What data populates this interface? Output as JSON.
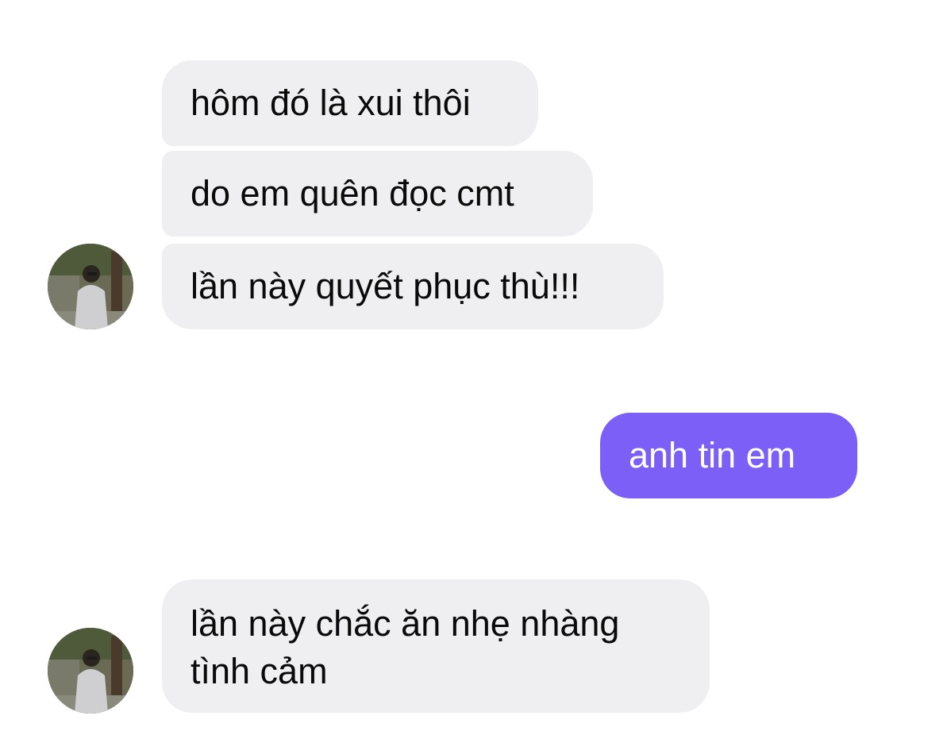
{
  "chat": {
    "messages": [
      {
        "sender": "contact",
        "text": "hôm đó là xui thôi"
      },
      {
        "sender": "contact",
        "text": "do em quên đọc cmt"
      },
      {
        "sender": "contact",
        "text": "lần này quyết phục thù!!!"
      },
      {
        "sender": "me",
        "text": "anh tin em"
      },
      {
        "sender": "contact",
        "lines": [
          "lần này chắc ăn nhẹ nhàng",
          "tình cảm"
        ]
      }
    ],
    "avatar_icon": "contact-avatar-photo",
    "colors": {
      "incoming_bubble": "#efeff2",
      "outgoing_bubble": "#7b5ff7",
      "background": "#ffffff"
    }
  }
}
